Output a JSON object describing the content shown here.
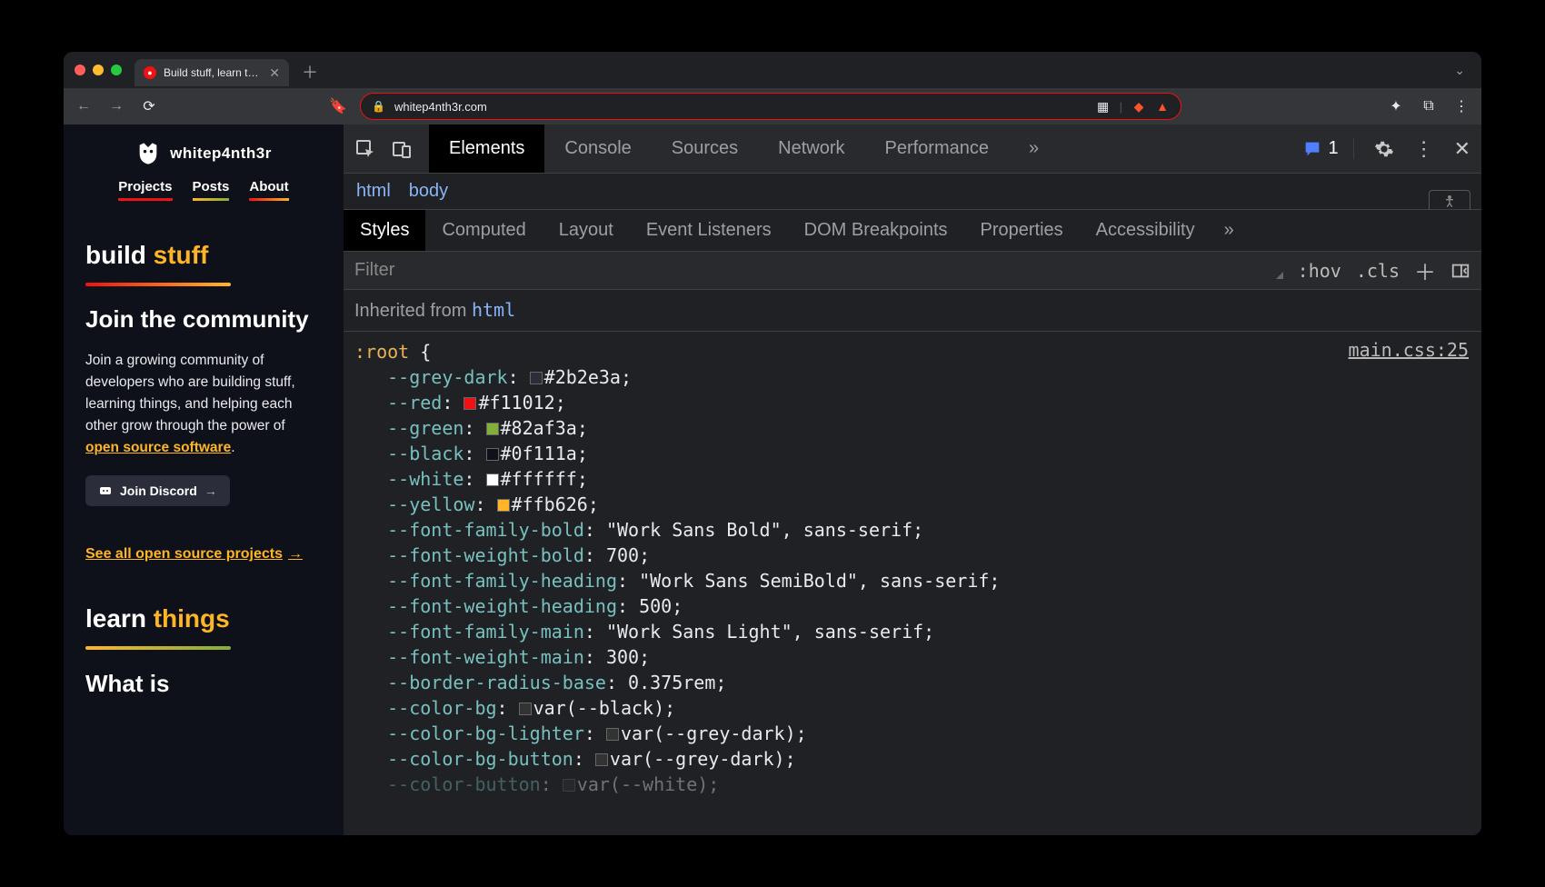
{
  "browser": {
    "tab_title": "Build stuff, learn things and l",
    "url": "whitep4nth3r.com"
  },
  "site": {
    "brand": "whitep4nth3r",
    "nav": {
      "projects": "Projects",
      "posts": "Posts",
      "about": "About"
    },
    "build": {
      "a": "build ",
      "b": "stuff"
    },
    "join_title": "Join the community",
    "para_a": "Join a growing community of developers who are building stuff, learning things, and helping each other grow through the power of ",
    "para_link": "open source software",
    "para_b": ".",
    "discord": "Join Discord",
    "see_all": "See all open source projects",
    "learn": {
      "a": "learn ",
      "b": "things"
    },
    "whatis": "What is"
  },
  "devtools": {
    "tabs": [
      "Elements",
      "Console",
      "Sources",
      "Network",
      "Performance"
    ],
    "issues_count": "1",
    "crumb": {
      "html": "html",
      "body": "body"
    },
    "subtabs": [
      "Styles",
      "Computed",
      "Layout",
      "Event Listeners",
      "DOM Breakpoints",
      "Properties",
      "Accessibility"
    ],
    "filter_placeholder": "Filter",
    "hov": ":hov",
    "cls": ".cls",
    "inherited_label": "Inherited from ",
    "inherited_from": "html",
    "source": "main.css:25",
    "selector": ":root",
    "decls": [
      {
        "prop": "--grey-dark",
        "swatch": "sw-gd",
        "val": "#2b2e3a"
      },
      {
        "prop": "--red",
        "swatch": "sw-r",
        "val": "#f11012"
      },
      {
        "prop": "--green",
        "swatch": "sw-g",
        "val": "#82af3a"
      },
      {
        "prop": "--black",
        "swatch": "sw-b",
        "val": "#0f111a"
      },
      {
        "prop": "--white",
        "swatch": "sw-w",
        "val": "#ffffff"
      },
      {
        "prop": "--yellow",
        "swatch": "sw-y",
        "val": "#ffb626"
      },
      {
        "prop": "--font-family-bold",
        "val": "\"Work Sans Bold\", sans-serif"
      },
      {
        "prop": "--font-weight-bold",
        "val": "700"
      },
      {
        "prop": "--font-family-heading",
        "val": "\"Work Sans SemiBold\", sans-serif"
      },
      {
        "prop": "--font-weight-heading",
        "val": "500"
      },
      {
        "prop": "--font-family-main",
        "val": "\"Work Sans Light\", sans-serif"
      },
      {
        "prop": "--font-weight-main",
        "val": "300"
      },
      {
        "prop": "--border-radius-base",
        "val": "0.375rem"
      },
      {
        "prop": "--color-bg",
        "swatch": "sw-v",
        "val": "var(--black)"
      },
      {
        "prop": "--color-bg-lighter",
        "swatch": "sw-v",
        "val": "var(--grey-dark)"
      },
      {
        "prop": "--color-bg-button",
        "swatch": "sw-v",
        "val": "var(--grey-dark)"
      },
      {
        "prop": "--color-button",
        "swatch": "sw-v",
        "val": "var(--white)",
        "cut": true
      }
    ]
  }
}
